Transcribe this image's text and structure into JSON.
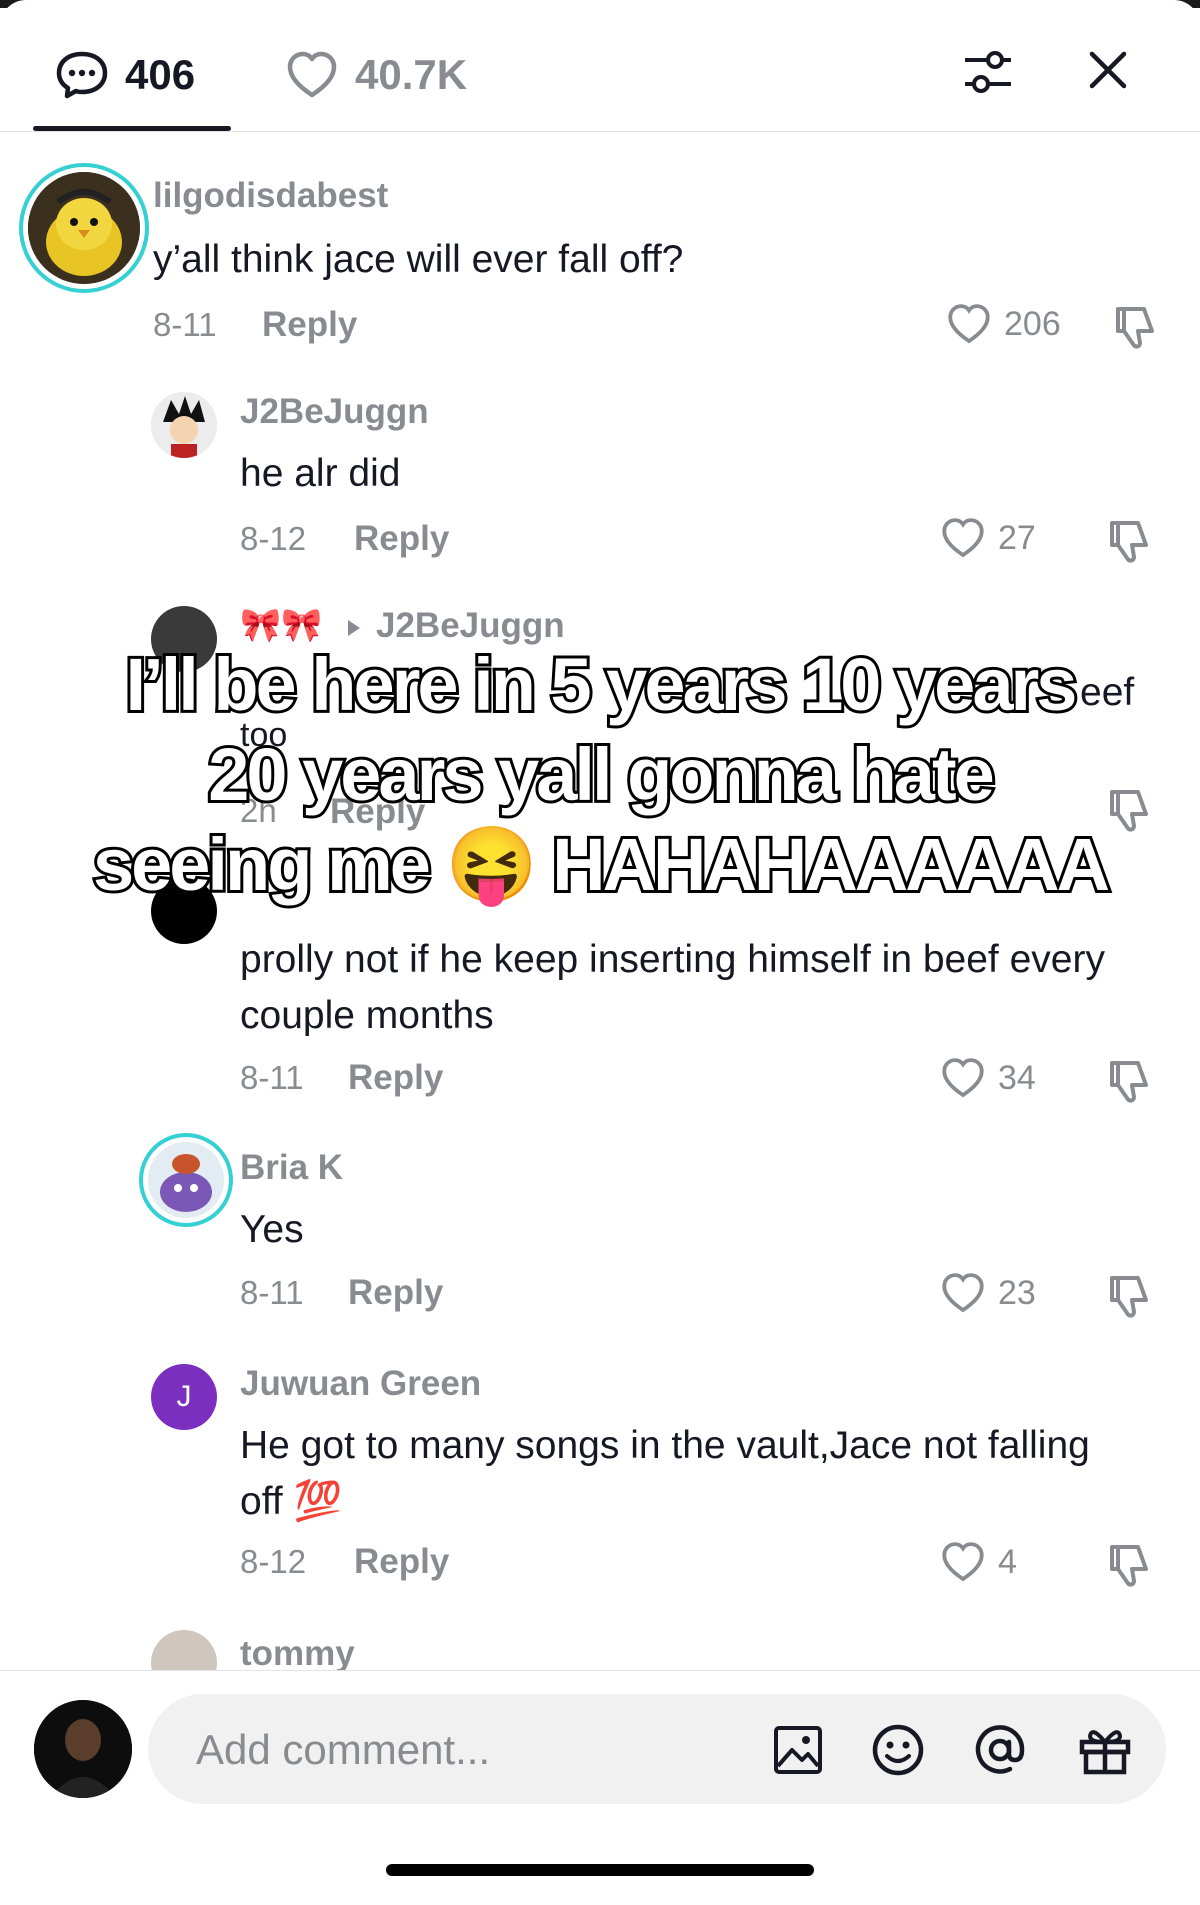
{
  "header": {
    "comment_count": "406",
    "like_count": "40.7K",
    "icons": [
      "comment-bubble-icon",
      "heart-outline-icon",
      "filter-sliders-icon",
      "close-icon"
    ]
  },
  "comments": [
    {
      "username": "lilgodisdabest",
      "text": "y’all think jace will ever fall off?",
      "date": "8-11",
      "reply": "Reply",
      "likes": "206"
    },
    {
      "username": "J2BeJuggn",
      "text": "he alr did",
      "date": "8-12",
      "reply": "Reply",
      "likes": "27"
    },
    {
      "username": "🎀🎀",
      "reply_to": "J2BeJuggn",
      "text_fragment_end": "eef",
      "text_fragment_2": "too",
      "date": "2h",
      "reply": "Reply"
    },
    {
      "text": "prolly not if he keep inserting himself in beef every couple months",
      "date": "8-11",
      "reply": "Reply",
      "likes": "34"
    },
    {
      "username": "Bria K",
      "text": "Yes",
      "date": "8-11",
      "reply": "Reply",
      "likes": "23"
    },
    {
      "username": "Juwuan Green",
      "avatar_letter": "J",
      "text": "He got to many songs in the vault,Jace not falling off",
      "emoji": "💯",
      "date": "8-12",
      "reply": "Reply",
      "likes": "4"
    },
    {
      "username": "tommy"
    }
  ],
  "overlay": {
    "line1": "I’ll be here in 5 years 10 years",
    "line2": "20 years yall gonna hate",
    "line3": "seeing me 😝 HAHAHAAAAAA"
  },
  "composer": {
    "placeholder": "Add comment...",
    "icons": [
      "image-icon",
      "emoji-icon",
      "mention-icon",
      "gift-icon"
    ]
  },
  "colors": {
    "text": "#161823",
    "muted": "#8a8b91",
    "ring": "#35d0d3",
    "avatar_purple": "#7b2fbf"
  }
}
